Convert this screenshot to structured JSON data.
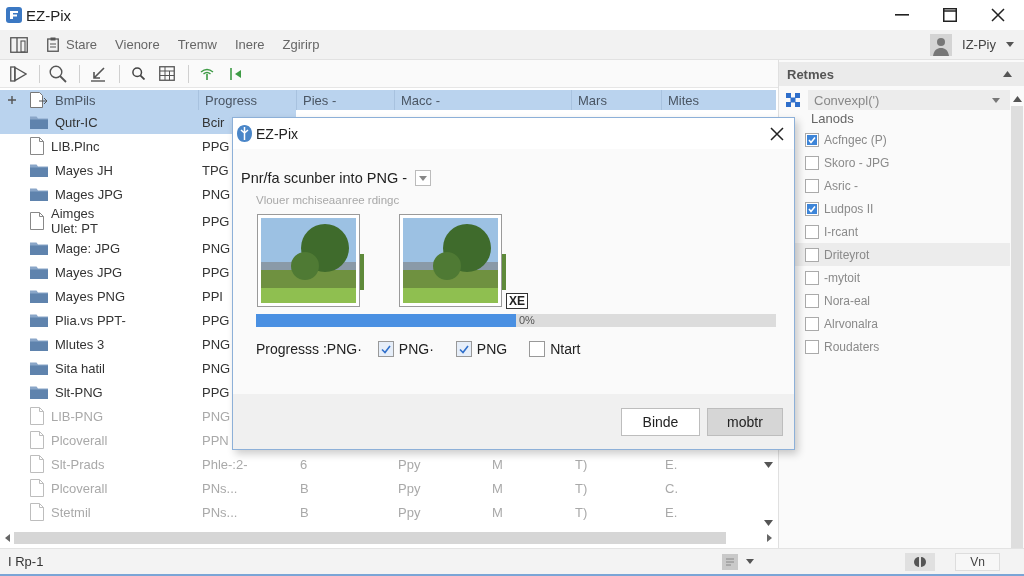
{
  "window": {
    "title": "EZ-Pix"
  },
  "menu": {
    "items": [
      {
        "label": "Stare",
        "kind": "icon"
      },
      {
        "label": "Vienore",
        "kind": "plain"
      },
      {
        "label": "Tremw",
        "kind": "plain"
      },
      {
        "label": "Inere",
        "kind": "plain"
      },
      {
        "label": "Zgirirp",
        "kind": "plain"
      }
    ]
  },
  "account": {
    "name": "IZ-Piy"
  },
  "table": {
    "columns": [
      "BmPils",
      "Progress",
      "Pies -",
      "Macc -",
      "",
      "Mars",
      "Mites"
    ],
    "rows": [
      {
        "kind": "folder",
        "selected": true,
        "disabled": false,
        "cells": [
          "Qutr-IC",
          "Bcir"
        ]
      },
      {
        "kind": "file",
        "selected": false,
        "disabled": false,
        "cells": [
          "LIB.Plnc",
          "PPG"
        ]
      },
      {
        "kind": "folder",
        "selected": false,
        "disabled": false,
        "cells": [
          "Mayes JH",
          "TPG"
        ]
      },
      {
        "kind": "folder",
        "selected": false,
        "disabled": false,
        "cells": [
          "Mages JPG",
          "PNG"
        ]
      },
      {
        "kind": "file",
        "selected": false,
        "disabled": false,
        "cells": [
          "Aimges\nUlet: PT",
          "PPG"
        ]
      },
      {
        "kind": "folder",
        "selected": false,
        "disabled": false,
        "cells": [
          "Mage: JPG",
          "PNG"
        ]
      },
      {
        "kind": "folder",
        "selected": false,
        "disabled": false,
        "cells": [
          "Mayes JPG",
          "PPG"
        ]
      },
      {
        "kind": "folder",
        "selected": false,
        "disabled": false,
        "cells": [
          "Mayes PNG",
          "PPI"
        ]
      },
      {
        "kind": "folder",
        "selected": false,
        "disabled": false,
        "cells": [
          "Plia.vs PPT-",
          "PPG"
        ]
      },
      {
        "kind": "folder",
        "selected": false,
        "disabled": false,
        "cells": [
          "Mlutes 3",
          "PNG"
        ]
      },
      {
        "kind": "folder",
        "selected": false,
        "disabled": false,
        "cells": [
          "Sita hatil",
          "PNG"
        ]
      },
      {
        "kind": "folder",
        "selected": false,
        "disabled": false,
        "cells": [
          "Slt-PNG",
          "PPG"
        ]
      },
      {
        "kind": "file",
        "selected": false,
        "disabled": true,
        "cells": [
          "LIB-PNG",
          "PNG"
        ]
      },
      {
        "kind": "file",
        "selected": false,
        "disabled": true,
        "cells": [
          "Plcoverall",
          "PPN"
        ]
      },
      {
        "kind": "file",
        "selected": false,
        "disabled": true,
        "cells": [
          "Slt-Prads",
          "Phle-:2-",
          "6",
          "Ppy",
          "M",
          "T)",
          "E."
        ]
      },
      {
        "kind": "file",
        "selected": false,
        "disabled": true,
        "cells": [
          "Plcoverall",
          "PNs...",
          "B",
          "Ppy",
          "M",
          "T)",
          "C."
        ]
      },
      {
        "kind": "file",
        "selected": false,
        "disabled": true,
        "cells": [
          "Stetmil",
          "PNs...",
          "B",
          "Ppy",
          "M",
          "T)",
          "E."
        ]
      }
    ]
  },
  "panel": {
    "title": "Retmes",
    "dropdown": {
      "value": "Convexpl(')"
    },
    "section": "Lanods",
    "items": [
      {
        "label": "Acfngec (P)",
        "checked": true,
        "selected": false
      },
      {
        "label": "Skoro - JPG",
        "checked": false,
        "selected": false
      },
      {
        "label": "Asric -",
        "checked": false,
        "selected": false
      },
      {
        "label": "Ludpos II",
        "checked": true,
        "selected": false
      },
      {
        "label": "I-rcant",
        "checked": false,
        "selected": false
      },
      {
        "label": "Driteyrot",
        "checked": false,
        "selected": true
      },
      {
        "label": "-mytoit",
        "checked": false,
        "selected": false
      },
      {
        "label": "Nora-eal",
        "checked": false,
        "selected": false
      },
      {
        "label": "Alrvonalra",
        "checked": false,
        "selected": false
      },
      {
        "label": "Roudaters",
        "checked": false,
        "selected": false
      }
    ]
  },
  "dialog": {
    "title": "EZ-Pix",
    "heading": "Pnr/fa scunber into PNG -",
    "subtitle": "Vlouer mchiseaanree rdingc",
    "tag": "XE",
    "progress": {
      "level": 0.5,
      "reading": "0%"
    },
    "options_label": "Progresss :PNG·",
    "options": [
      {
        "label": "PNG·",
        "checked": true
      },
      {
        "label": "PNG",
        "checked": true
      },
      {
        "label": "Ntart",
        "checked": false
      }
    ],
    "buttons": [
      {
        "label": "Binde",
        "kind": "normal"
      },
      {
        "label": "mobtr",
        "kind": "default"
      }
    ]
  },
  "status_bar": {
    "text": "I Rp-1",
    "button": "Vn"
  }
}
